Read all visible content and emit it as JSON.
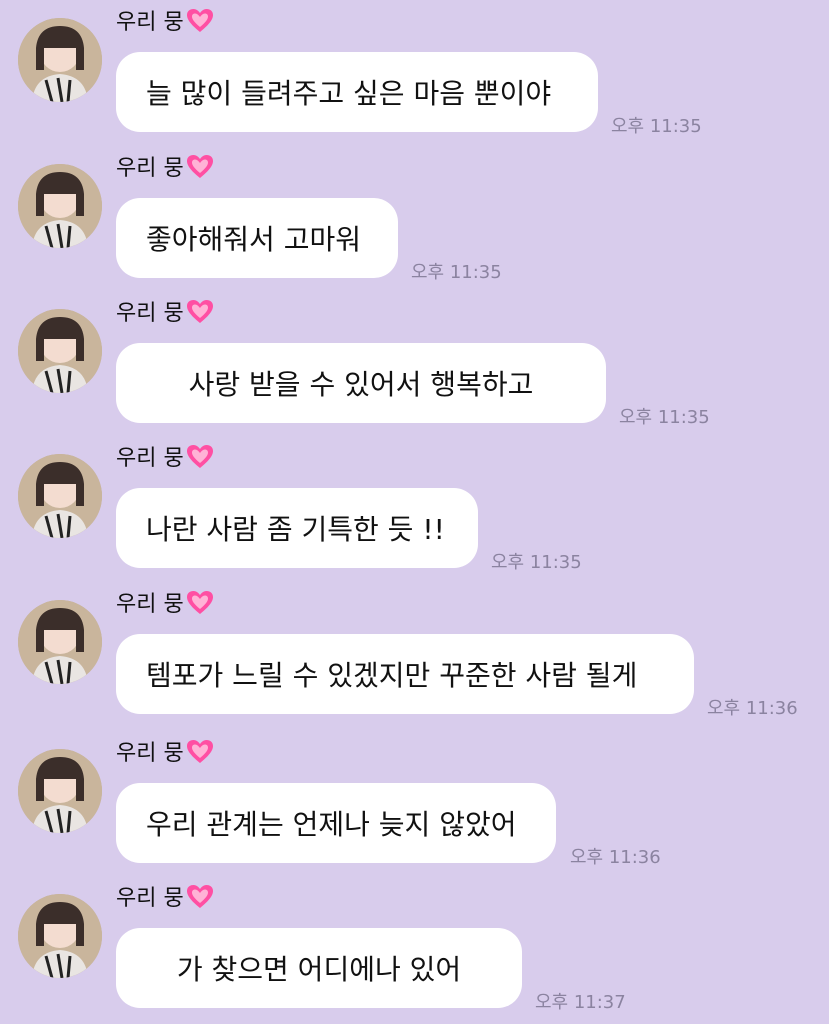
{
  "chat": {
    "messages": [
      {
        "sender": "우리 뭉",
        "text": "늘 많이 들려주고 싶은 마음 뿐이야",
        "time": "오후 11:35"
      },
      {
        "sender": "우리 뭉",
        "text": "좋아해줘서 고마워",
        "time": "오후 11:35"
      },
      {
        "sender": "우리 뭉",
        "text": "사랑 받을 수 있어서 행복하고",
        "time": "오후 11:35"
      },
      {
        "sender": "우리 뭉",
        "text": "나란 사람 좀 기특한 듯 !!",
        "time": "오후 11:35"
      },
      {
        "sender": "우리 뭉",
        "text": "템포가 느릴 수 있겠지만 꾸준한 사람 될게",
        "time": "오후 11:36"
      },
      {
        "sender": "우리 뭉",
        "text": "우리 관계는 언제나 늦지 않았어",
        "time": "오후 11:36"
      },
      {
        "sender": "우리 뭉",
        "text": "가 찾으면 어디에나 있어",
        "time": "오후 11:37"
      }
    ]
  },
  "colors": {
    "background": "#d8ccec",
    "bubble": "#ffffff",
    "timestamp": "#8b83a0",
    "heart": "#ff4fa3"
  },
  "icons": {
    "sender_badge": "pink-heart-icon"
  }
}
